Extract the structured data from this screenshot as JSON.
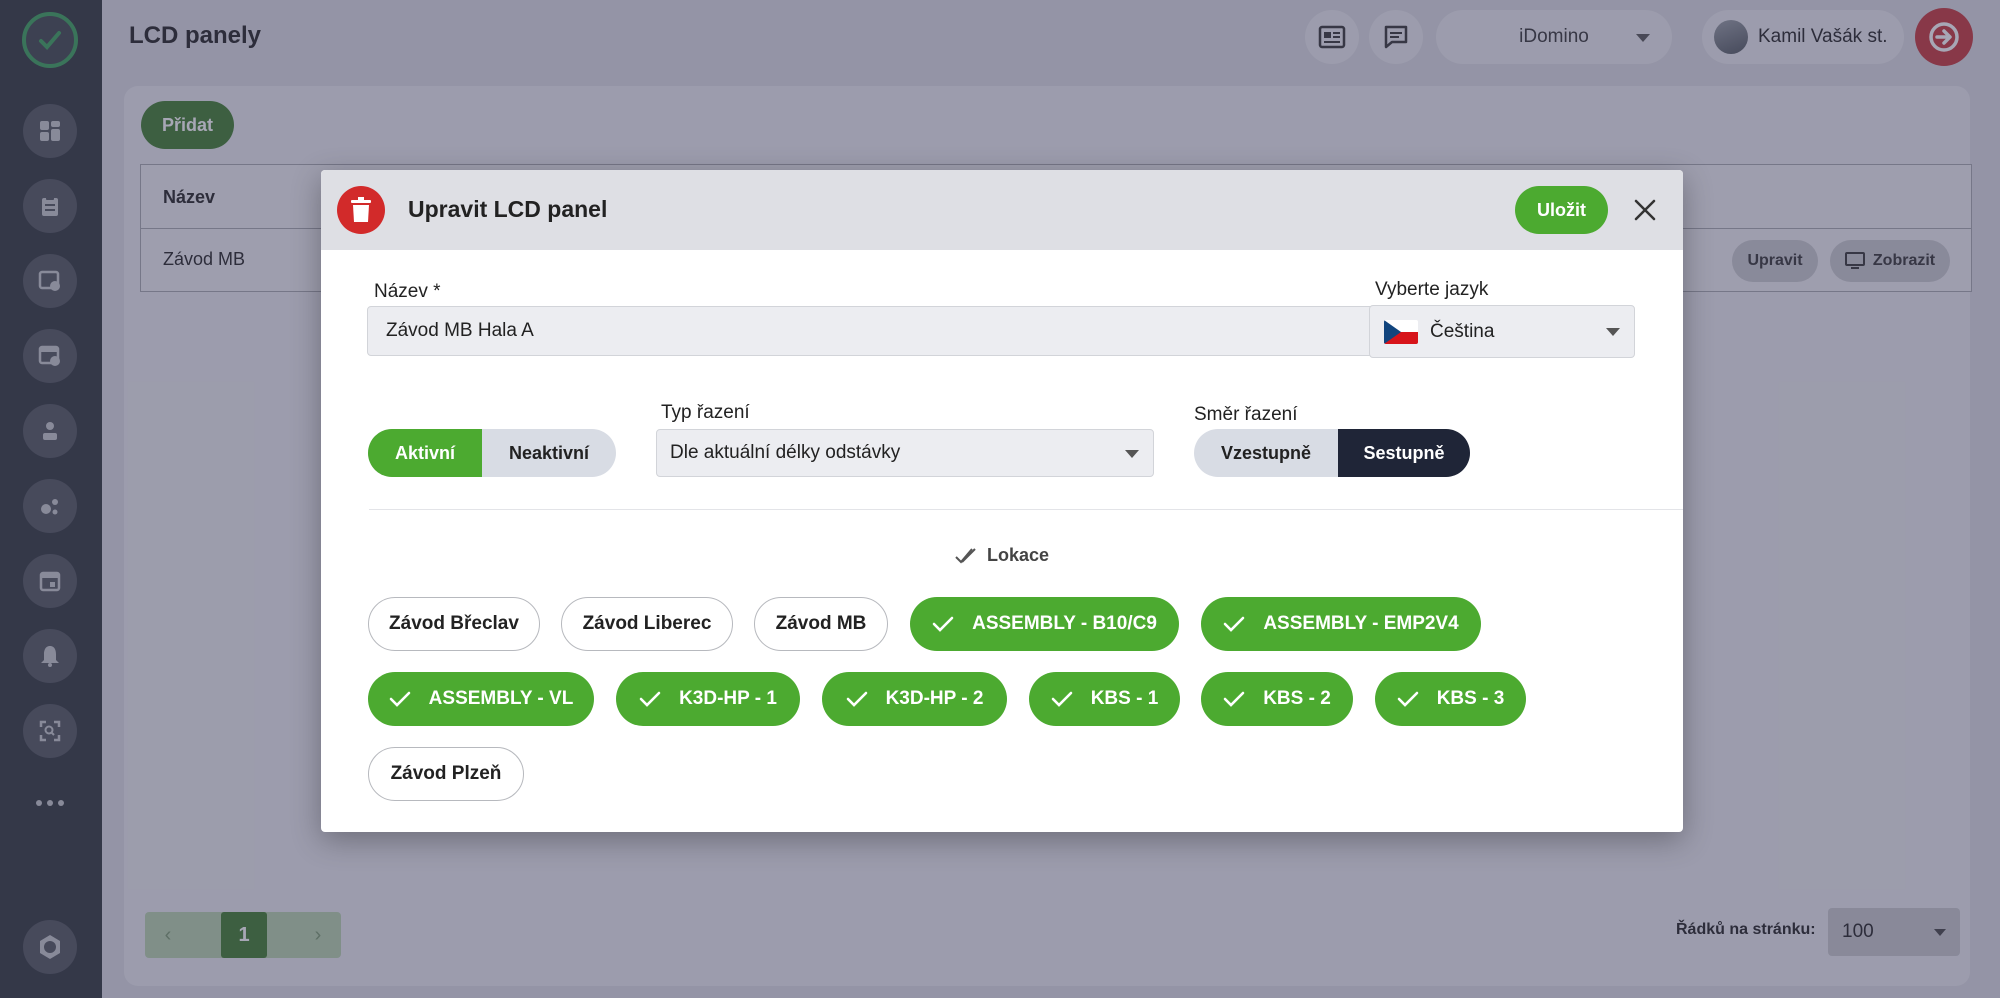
{
  "page": {
    "title": "LCD panely"
  },
  "header": {
    "company_select": "iDomino",
    "user_name": "Kamil Vašák st."
  },
  "sidebar": {
    "items": [
      "logo-icon",
      "dashboard-icon",
      "clipboard-icon",
      "schedule-icon",
      "calendar-clock-icon",
      "operator-icon",
      "molecule-icon",
      "calendar-icon",
      "bell-icon",
      "scan-icon",
      "more-icon",
      "settings-icon"
    ]
  },
  "main": {
    "add_label": "Přidat",
    "table": {
      "column_name": "Název",
      "rows": [
        {
          "name": "Závod MB",
          "edit_label": "Upravit",
          "view_label": "Zobrazit"
        }
      ]
    },
    "pagination": {
      "current": "1",
      "rows_label": "Řádků na stránku:",
      "rows_value": "100"
    }
  },
  "modal": {
    "title": "Upravit LCD panel",
    "save_label": "Uložit",
    "name_label": "Název *",
    "name_value": "Závod MB Hala A",
    "lang_label": "Vyberte jazyk",
    "lang_value": "Čeština",
    "status": {
      "active": "Aktivní",
      "inactive": "Neaktivní",
      "selected": "Aktivní"
    },
    "sort_type_label": "Typ řazení",
    "sort_type_value": "Dle aktuální délky odstávky",
    "sort_dir_label": "Směr řazení",
    "sort_dir": {
      "asc": "Vzestupně",
      "desc": "Sestupně",
      "selected": "Sestupně"
    },
    "locations_label": "Lokace",
    "locations": [
      {
        "name": "Závod Břeclav",
        "selected": false
      },
      {
        "name": "Závod Liberec",
        "selected": false
      },
      {
        "name": "Závod MB",
        "selected": false
      },
      {
        "name": "ASSEMBLY - B10/C9",
        "selected": true
      },
      {
        "name": "ASSEMBLY - EMP2V4",
        "selected": true
      },
      {
        "name": "ASSEMBLY - VL",
        "selected": true
      },
      {
        "name": "K3D-HP - 1",
        "selected": true
      },
      {
        "name": "K3D-HP - 2",
        "selected": true
      },
      {
        "name": "KBS - 1",
        "selected": true
      },
      {
        "name": "KBS - 2",
        "selected": true
      },
      {
        "name": "KBS - 3",
        "selected": true
      },
      {
        "name": "Závod Plzeň",
        "selected": false
      }
    ]
  },
  "colors": {
    "accent_green": "#4caa30",
    "dark_green": "#3f7d2c",
    "danger": "#d22a2a",
    "dark_navy": "#1f2537"
  }
}
